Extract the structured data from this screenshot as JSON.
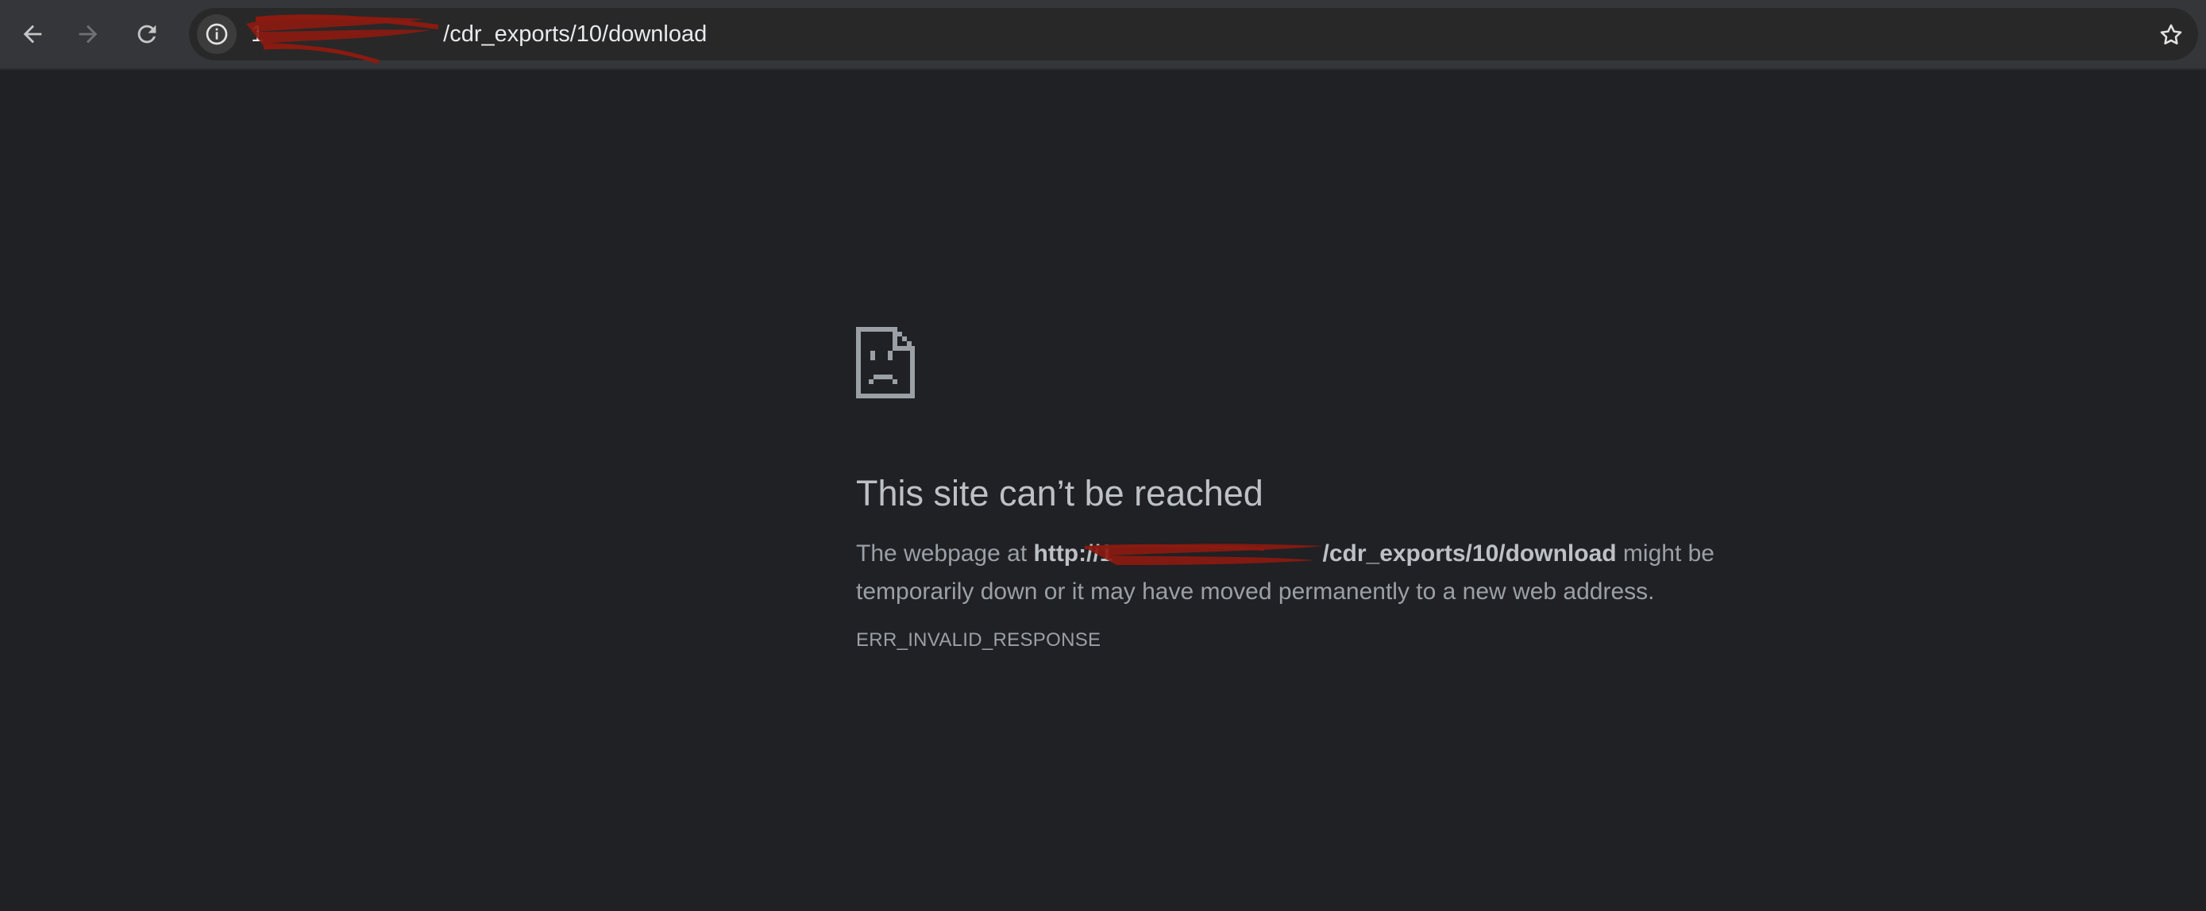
{
  "toolbar": {
    "back_icon": "arrow-left-icon",
    "forward_icon": "arrow-right-icon",
    "reload_icon": "reload-icon",
    "bookmark_icon": "star-icon"
  },
  "omnibox": {
    "site_info_icon": "info-icon",
    "url_host_visible": "1",
    "url_path": "/cdr_exports/10/download"
  },
  "error": {
    "title": "This site can’t be reached",
    "desc_prefix": "The webpage at ",
    "desc_url_start": "http://1",
    "desc_url_end": "/cdr_exports/10/download",
    "desc_suffix": " might be temporarily down or it may have moved permanently to a new web address.",
    "code": "ERR_INVALID_RESPONSE",
    "icon": "sad-page-icon"
  },
  "colors": {
    "page_bg": "#202124",
    "toolbar_bg": "#35363a",
    "omnibox_bg": "#282828",
    "redaction": "#8b1a10"
  }
}
